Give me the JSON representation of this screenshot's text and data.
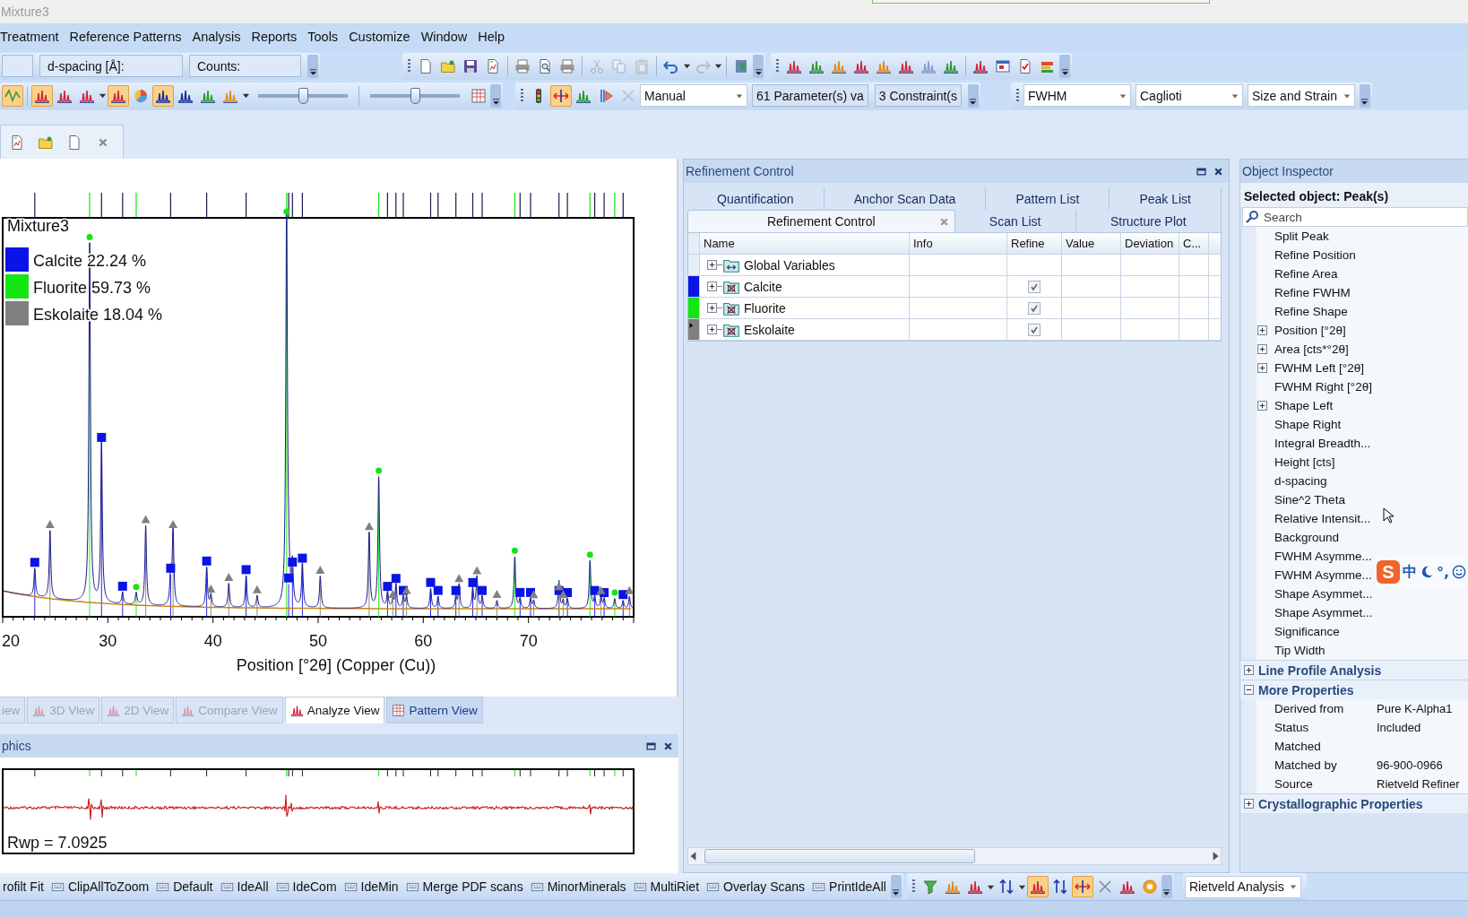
{
  "window": {
    "title": "Mixture3"
  },
  "menu": [
    {
      "label": "Treatment"
    },
    {
      "label": "Reference Patterns"
    },
    {
      "label": "Analysis"
    },
    {
      "label": "Reports"
    },
    {
      "label": "Tools"
    },
    {
      "label": "Customize"
    },
    {
      "label": "Window"
    },
    {
      "label": "Help"
    }
  ],
  "toolbar_1": [
    {
      "items": [
        {
          "kind": "field"
        },
        {
          "kind": "field",
          "label": "d-spacing [Å]:"
        },
        {
          "kind": "field",
          "label": "Counts:"
        },
        {
          "kind": "overflow"
        }
      ]
    },
    {
      "items": [
        {
          "kind": "grip"
        },
        {
          "kind": "icon",
          "on": false,
          "disabled": false
        },
        {
          "kind": "icon",
          "on": false,
          "disabled": false
        },
        {
          "kind": "icon",
          "on": false,
          "disabled": false
        },
        {
          "kind": "icon",
          "on": false,
          "disabled": false
        },
        {
          "kind": "sep"
        },
        {
          "kind": "icon",
          "on": false,
          "disabled": false
        },
        {
          "kind": "icon",
          "on": false,
          "disabled": false
        },
        {
          "kind": "icon",
          "on": false,
          "disabled": false
        },
        {
          "kind": "sep"
        },
        {
          "kind": "icon",
          "on": false,
          "disabled": true
        },
        {
          "kind": "icon",
          "on": false,
          "disabled": true
        },
        {
          "kind": "icon",
          "on": false,
          "disabled": true
        },
        {
          "kind": "sep"
        },
        {
          "kind": "icon",
          "on": false,
          "disabled": false
        },
        {
          "kind": "caret"
        },
        {
          "kind": "icon",
          "on": false,
          "disabled": true
        },
        {
          "kind": "caret"
        },
        {
          "kind": "sep"
        },
        {
          "kind": "icon",
          "on": false,
          "disabled": false
        },
        {
          "kind": "overflow"
        }
      ]
    },
    {
      "items": [
        {
          "kind": "grip"
        },
        {
          "kind": "icon",
          "on": false,
          "disabled": false
        },
        {
          "kind": "icon",
          "on": false,
          "disabled": false
        },
        {
          "kind": "icon",
          "on": false,
          "disabled": false
        },
        {
          "kind": "icon",
          "on": false,
          "disabled": false
        },
        {
          "kind": "icon",
          "on": false,
          "disabled": false
        },
        {
          "kind": "icon",
          "on": false,
          "disabled": false
        },
        {
          "kind": "icon",
          "on": false,
          "disabled": true
        },
        {
          "kind": "icon",
          "on": false,
          "disabled": false
        },
        {
          "kind": "sep"
        },
        {
          "kind": "icon",
          "on": false,
          "disabled": false
        },
        {
          "kind": "icon",
          "on": false,
          "disabled": false
        },
        {
          "kind": "icon",
          "on": false,
          "disabled": false
        },
        {
          "kind": "icon",
          "on": false,
          "disabled": false
        },
        {
          "kind": "overflow"
        }
      ]
    }
  ],
  "toolbar_2": [
    {
      "items": [
        {
          "kind": "icon",
          "on": true,
          "disabled": false
        },
        {
          "kind": "sep"
        },
        {
          "kind": "icon",
          "on": true,
          "disabled": false
        },
        {
          "kind": "icon",
          "on": false,
          "disabled": false
        },
        {
          "kind": "icon",
          "on": false,
          "disabled": false
        },
        {
          "kind": "caret"
        },
        {
          "kind": "icon",
          "on": true,
          "disabled": false
        },
        {
          "kind": "icon",
          "on": false,
          "disabled": false
        },
        {
          "kind": "icon",
          "on": true,
          "disabled": false
        },
        {
          "kind": "icon",
          "on": false,
          "disabled": false
        },
        {
          "kind": "icon",
          "on": false,
          "disabled": false
        },
        {
          "kind": "icon",
          "on": false,
          "disabled": false
        },
        {
          "kind": "caret"
        },
        {
          "kind": "slider",
          "level": 0.5
        },
        {
          "kind": "sep"
        },
        {
          "kind": "slider",
          "level": 0.5
        },
        {
          "kind": "icon",
          "on": false,
          "disabled": false
        },
        {
          "kind": "overflow"
        }
      ]
    },
    {
      "items": [
        {
          "kind": "grip"
        },
        {
          "kind": "icon",
          "on": false,
          "disabled": false
        },
        {
          "kind": "icon",
          "on": true,
          "disabled": false
        },
        {
          "kind": "icon",
          "on": false,
          "disabled": false
        },
        {
          "kind": "icon",
          "on": false,
          "disabled": false
        },
        {
          "kind": "icon",
          "on": false,
          "disabled": true
        },
        {
          "kind": "dropdown",
          "label": "Manual"
        },
        {
          "kind": "box",
          "label": "61 Parameter(s) va"
        },
        {
          "kind": "box",
          "label": "3 Constraint(s"
        },
        {
          "kind": "overflow"
        }
      ]
    },
    {
      "items": [
        {
          "kind": "grip"
        },
        {
          "kind": "dropdown",
          "label": "FWHM"
        },
        {
          "kind": "dropdown",
          "label": "Caglioti"
        },
        {
          "kind": "dropdown",
          "label": "Size and Strain"
        },
        {
          "kind": "overflow"
        }
      ]
    }
  ],
  "chart_view": {
    "legend_title": "Mixture3",
    "legend": [
      {
        "label": "Calcite 22.24 %",
        "color": "#0a14e6"
      },
      {
        "label": "Fluorite 59.73 %",
        "color": "#14e614"
      },
      {
        "label": "Eskolaite 18.04 %",
        "color": "#808080"
      }
    ],
    "x_ticks": [
      "20",
      "30",
      "40",
      "50",
      "60",
      "70"
    ],
    "x_label": "Position [°2θ] (Copper (Cu))",
    "view_tabs": [
      {
        "label": "iew",
        "disabled": true,
        "selected": false
      },
      {
        "label": "3D View",
        "disabled": true,
        "selected": false
      },
      {
        "label": "2D View",
        "disabled": true,
        "selected": false
      },
      {
        "label": "Compare View",
        "disabled": true,
        "selected": false
      },
      {
        "label": "Analyze View",
        "disabled": false,
        "selected": true
      },
      {
        "label": "Pattern View",
        "disabled": false,
        "selected": false
      }
    ]
  },
  "difference_panel": {
    "title": "phics",
    "rwp": "Rwp = 7.0925"
  },
  "refinement_control": {
    "title": "Refinement Control",
    "tabs_row_1": [
      {
        "label": "Quantification",
        "selected": false
      },
      {
        "label": "Anchor Scan Data",
        "selected": false
      },
      {
        "label": "Pattern List",
        "selected": false
      },
      {
        "label": "Peak List",
        "selected": false
      }
    ],
    "tabs_row_2": [
      {
        "label": "Refinement Control",
        "selected": true
      },
      {
        "label": "Scan List",
        "selected": false
      },
      {
        "label": "Structure Plot",
        "selected": false
      }
    ],
    "columns": [
      "Name",
      "Info",
      "Refine",
      "Value",
      "Deviation",
      "C..."
    ],
    "rows": [
      {
        "name": "Global Variables",
        "kind": "variables",
        "current": false
      },
      {
        "name": "Calcite",
        "kind": "phase",
        "color": "#0a14e6",
        "checked": true,
        "current": false
      },
      {
        "name": "Fluorite",
        "kind": "phase",
        "color": "#14e614",
        "checked": true,
        "current": false
      },
      {
        "name": "Eskolaite",
        "kind": "phase",
        "color": "#808080",
        "checked": true,
        "current": true
      }
    ]
  },
  "object_inspector": {
    "title": "Object Inspector",
    "selected_object": "Selected object: Peak(s)",
    "search": {
      "placeholder": "Search"
    },
    "properties": [
      {
        "label": "Split Peak",
        "expandable": false
      },
      {
        "label": "Refine Position",
        "expandable": false
      },
      {
        "label": "Refine Area",
        "expandable": false
      },
      {
        "label": "Refine FWHM",
        "expandable": false
      },
      {
        "label": "Refine Shape",
        "expandable": false
      },
      {
        "label": "Position [°2θ]",
        "expandable": true
      },
      {
        "label": "Area [cts*°2θ]",
        "expandable": true
      },
      {
        "label": "FWHM Left [°2θ]",
        "expandable": true
      },
      {
        "label": "FWHM Right [°2θ]",
        "expandable": false
      },
      {
        "label": "Shape Left",
        "expandable": true
      },
      {
        "label": "Shape Right",
        "expandable": false
      },
      {
        "label": "Integral Breadth...",
        "expandable": false
      },
      {
        "label": "Height [cts]",
        "expandable": false
      },
      {
        "label": "d-spacing",
        "expandable": false
      },
      {
        "label": "Sine^2 Theta",
        "expandable": false
      },
      {
        "label": "Relative Intensit...",
        "expandable": false
      },
      {
        "label": "Background",
        "expandable": false
      },
      {
        "label": "FWHM Asymme...",
        "expandable": false
      },
      {
        "label": "FWHM Asymme...",
        "expandable": false
      },
      {
        "label": "Shape Asymmet...",
        "expandable": false
      },
      {
        "label": "Shape Asymmet...",
        "expandable": false
      },
      {
        "label": "Significance",
        "expandable": false
      },
      {
        "label": "Tip Width",
        "expandable": false
      }
    ],
    "sections": [
      {
        "label": "Line Profile Analysis",
        "expanded": false
      },
      {
        "label": "More Properties",
        "expanded": true,
        "rows": [
          {
            "label": "Derived from",
            "value": "Pure K-Alpha1"
          },
          {
            "label": "Status",
            "value": "Included"
          },
          {
            "label": "Matched"
          },
          {
            "label": "Matched by",
            "value": "96-900-0966"
          },
          {
            "label": "Source",
            "value": "Rietveld Refiner"
          }
        ]
      },
      {
        "label": "Crystallographic Properties",
        "expanded": false
      }
    ]
  },
  "ime_bar": {
    "logo": "S",
    "language": "中",
    "punctuation": "°,"
  },
  "bottom_toolbar": [
    {
      "items": [
        {
          "kind": "label",
          "label": "rofilt Fit"
        },
        {
          "kind": "macro",
          "label": "ClipAllToZoom"
        },
        {
          "kind": "macro",
          "label": "Default"
        },
        {
          "kind": "macro",
          "label": "IdeAll"
        },
        {
          "kind": "macro",
          "label": "IdeCom"
        },
        {
          "kind": "macro",
          "label": "IdeMin"
        },
        {
          "kind": "macro",
          "label": "Merge PDF scans"
        },
        {
          "kind": "macro",
          "label": "MinorMinerals"
        },
        {
          "kind": "macro",
          "label": "MultiRiet"
        },
        {
          "kind": "macro",
          "label": "Overlay Scans"
        },
        {
          "kind": "macro",
          "label": "PrintIdeAll"
        },
        {
          "kind": "overflow"
        }
      ]
    },
    {
      "items": [
        {
          "kind": "grip"
        },
        {
          "kind": "icon",
          "on": false,
          "disabled": false
        },
        {
          "kind": "icon",
          "on": false,
          "disabled": false
        },
        {
          "kind": "icon",
          "on": false,
          "disabled": false
        },
        {
          "kind": "caret"
        },
        {
          "kind": "icon",
          "on": false,
          "disabled": false
        },
        {
          "kind": "caret"
        },
        {
          "kind": "icon",
          "on": true,
          "disabled": false
        },
        {
          "kind": "icon",
          "on": false,
          "disabled": false
        },
        {
          "kind": "icon",
          "on": true,
          "disabled": false
        },
        {
          "kind": "icon",
          "on": false,
          "disabled": false
        },
        {
          "kind": "icon",
          "on": false,
          "disabled": false
        },
        {
          "kind": "icon",
          "on": false,
          "disabled": false
        },
        {
          "kind": "overflow"
        }
      ]
    },
    {
      "items": [
        {
          "kind": "dropdown",
          "label": "Rietveld Analysis"
        }
      ]
    }
  ]
}
